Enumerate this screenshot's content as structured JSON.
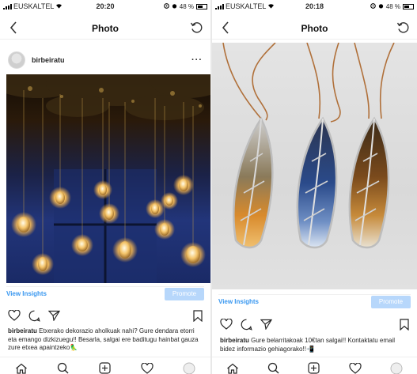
{
  "left": {
    "status": {
      "carrier": "EUSKALTEL",
      "time": "20:20",
      "battery": "48 %"
    },
    "nav": {
      "title": "Photo",
      "back_icon": "chevron-left-icon",
      "refresh_icon": "refresh-icon"
    },
    "post": {
      "username": "birbeiratu",
      "more": "···",
      "insights_label": "View Insights",
      "promote_label": "Promote",
      "caption_user": "birbeiratu",
      "caption_text": "Etxerako dekorazio aholkuak nahi? Gure dendara etorri eta emango dizkizuegu!! Besarla, salgai ere baditugu hainbat gauza zure etxea apaintzeko🦜"
    }
  },
  "right": {
    "status": {
      "carrier": "EUSKALTEL",
      "time": "20:18",
      "battery": "48 %"
    },
    "nav": {
      "title": "Photo",
      "back_icon": "chevron-left-icon",
      "refresh_icon": "refresh-icon"
    },
    "post": {
      "insights_label": "View Insights",
      "promote_label": "Promote",
      "caption_user": "birbeiratu",
      "caption_text": "Gure belarritakoak 10€tan salgai!! Kontaktatu email bidez informazio gehiagorako!!📲"
    }
  },
  "tabbar": [
    "home-icon",
    "search-icon",
    "add-post-icon",
    "activity-heart-icon",
    "profile-icon"
  ],
  "colors": {
    "accent": "#3897f0",
    "promote_disabled": "#b7d7fb",
    "text": "#262626"
  }
}
